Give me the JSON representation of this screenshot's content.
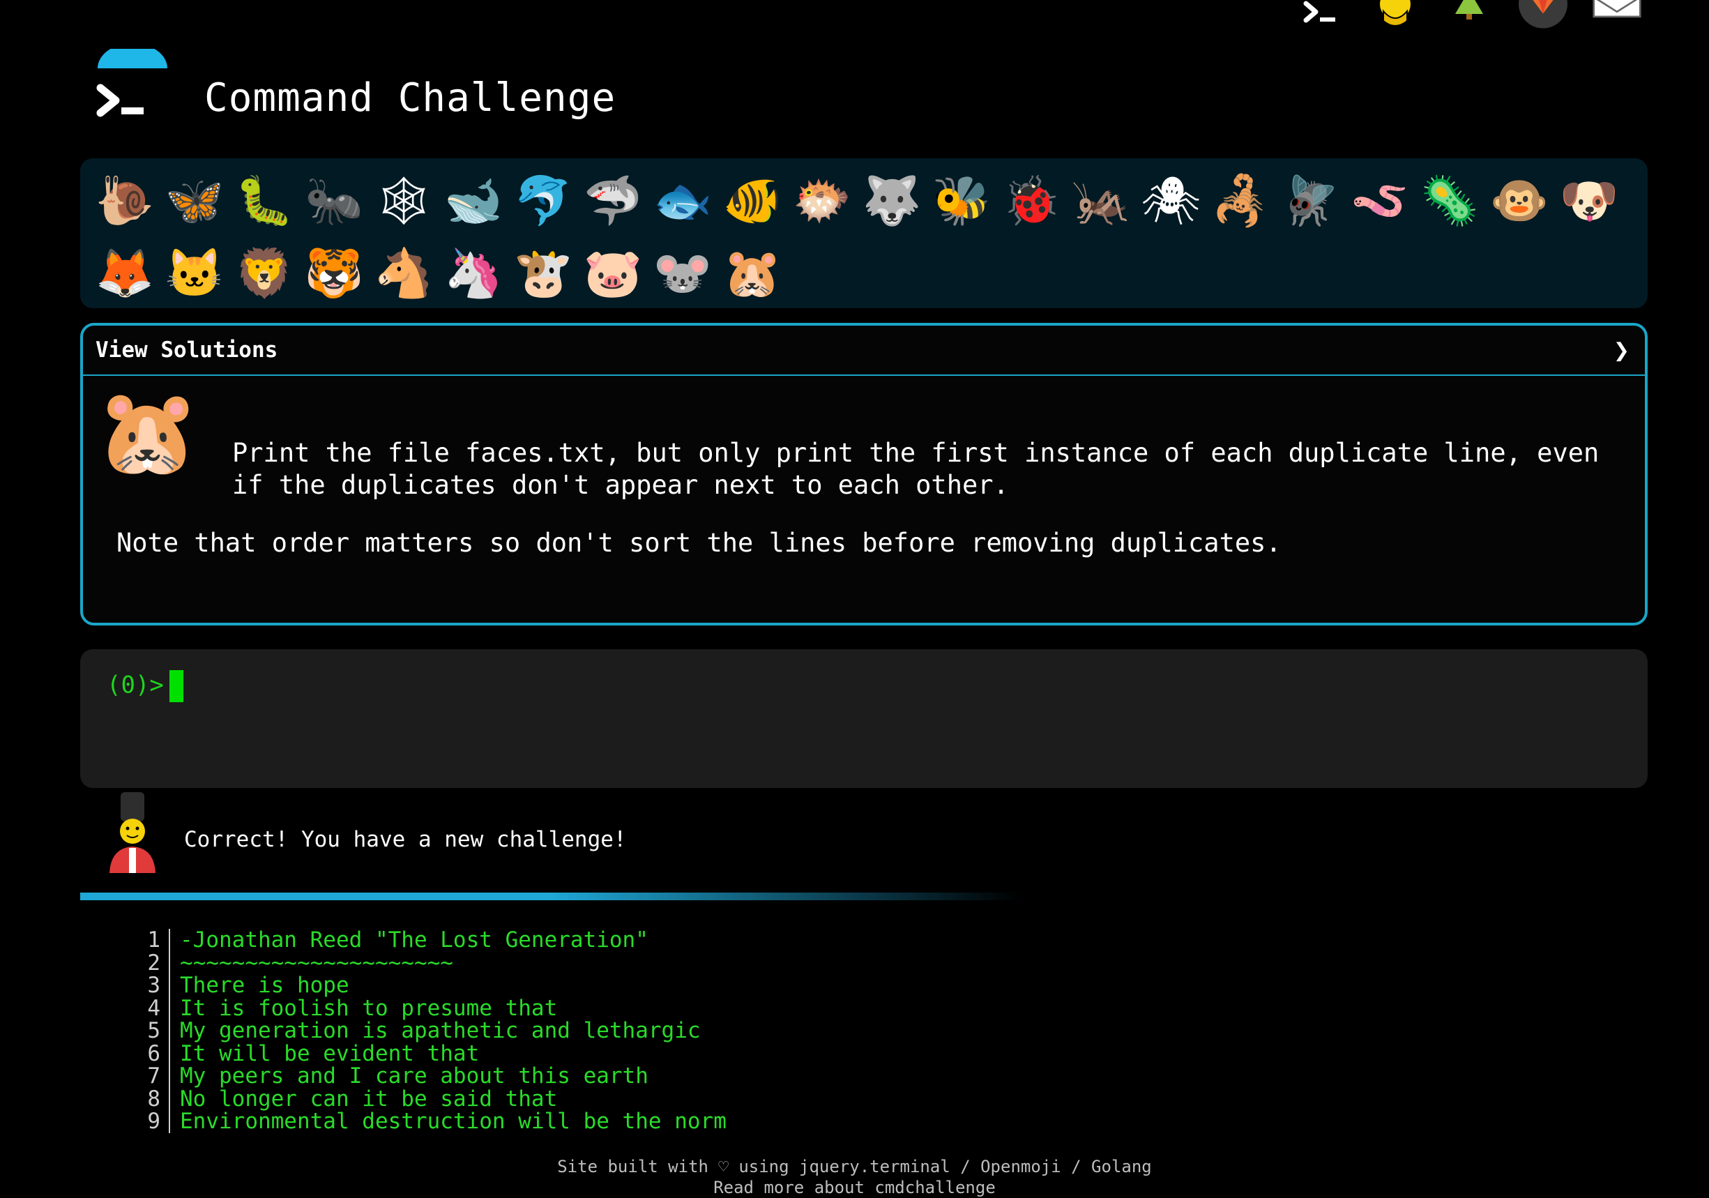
{
  "header": {
    "title": "Command Challenge"
  },
  "top_icons": [
    "terminal-icon",
    "lightbulb-hand-icon",
    "tree-icon",
    "gitlab-icon",
    "mail-icon"
  ],
  "animals": [
    {
      "name": "snail",
      "glyph": "🐌"
    },
    {
      "name": "butterfly",
      "glyph": "🦋"
    },
    {
      "name": "caterpillar",
      "glyph": "🐛"
    },
    {
      "name": "ant",
      "glyph": "🐜"
    },
    {
      "name": "spider-web",
      "glyph": "🕸"
    },
    {
      "name": "whale",
      "glyph": "🐋"
    },
    {
      "name": "dolphin",
      "glyph": "🐬"
    },
    {
      "name": "shark",
      "glyph": "🦈"
    },
    {
      "name": "fish",
      "glyph": "🐟"
    },
    {
      "name": "tropical-fish",
      "glyph": "🐠"
    },
    {
      "name": "blowfish",
      "glyph": "🐡"
    },
    {
      "name": "wolf",
      "glyph": "🐺"
    },
    {
      "name": "bee",
      "glyph": "🐝"
    },
    {
      "name": "ladybug",
      "glyph": "🐞"
    },
    {
      "name": "cricket",
      "glyph": "🦗"
    },
    {
      "name": "spider",
      "glyph": "🕷"
    },
    {
      "name": "scorpion",
      "glyph": "🦂"
    },
    {
      "name": "fly",
      "glyph": "🪰"
    },
    {
      "name": "worm",
      "glyph": "🪱"
    },
    {
      "name": "microbe",
      "glyph": "🦠"
    },
    {
      "name": "monkey",
      "glyph": "🐵"
    },
    {
      "name": "dog",
      "glyph": "🐶"
    },
    {
      "name": "fox",
      "glyph": "🦊"
    },
    {
      "name": "cat",
      "glyph": "🐱"
    },
    {
      "name": "lion",
      "glyph": "🦁"
    },
    {
      "name": "tiger",
      "glyph": "🐯"
    },
    {
      "name": "horse",
      "glyph": "🐴"
    },
    {
      "name": "unicorn",
      "glyph": "🦄"
    },
    {
      "name": "cow",
      "glyph": "🐮"
    },
    {
      "name": "pig",
      "glyph": "🐷"
    },
    {
      "name": "mouse",
      "glyph": "🐭"
    },
    {
      "name": "hamster",
      "glyph": "🐹"
    }
  ],
  "panel": {
    "head_label": "View Solutions",
    "chevron": "❯",
    "icon_glyph": "🐹",
    "description_1": "Print the file faces.txt, but only print the first instance of each duplicate line, even if the duplicates don't appear next to each other.",
    "description_2": "Note that order matters so don't sort the lines before removing duplicates."
  },
  "terminal": {
    "prompt": "(0)>"
  },
  "result": {
    "message": "Correct! You have a new challenge!",
    "progress": 0.55
  },
  "output": {
    "lines": [
      {
        "n": "1",
        "text": "-Jonathan Reed \"The Lost Generation\""
      },
      {
        "n": "2",
        "text": "~~~~~~~~~~~~~~~~~~~~~"
      },
      {
        "n": "3",
        "text": "There is hope"
      },
      {
        "n": "4",
        "text": "It is foolish to presume that"
      },
      {
        "n": "5",
        "text": "My generation is apathetic and lethargic"
      },
      {
        "n": "6",
        "text": "It will be evident that"
      },
      {
        "n": "7",
        "text": "My peers and I care about this earth"
      },
      {
        "n": "8",
        "text": "No longer can it be said that"
      },
      {
        "n": "9",
        "text": "Environmental destruction will be the norm"
      }
    ]
  },
  "footer": {
    "line1": "Site built with ♡ using jquery.terminal / Openmoji / Golang",
    "line2": "Read more about cmdchallenge"
  },
  "colors": {
    "accent": "#1aa6c8",
    "output_green": "#2adb2a",
    "panel_bg": "#021a24"
  }
}
